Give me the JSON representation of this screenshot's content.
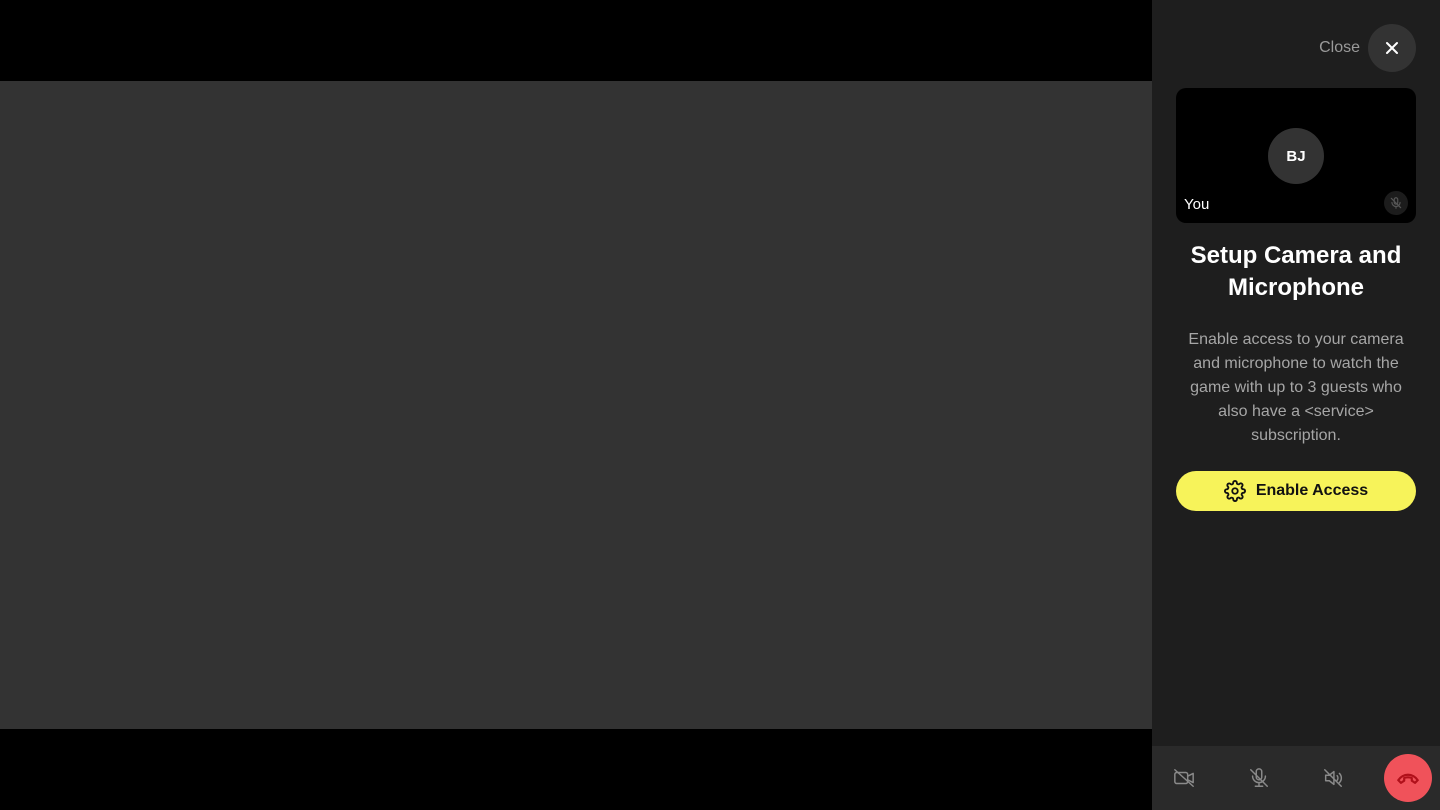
{
  "panel": {
    "close_label": "Close",
    "preview": {
      "initials": "BJ",
      "self_label": "You"
    },
    "title": "Setup Camera and Microphone",
    "description": "Enable access to your camera and microphone to watch the game with up to 3 guests who also have a <service> subscription.",
    "enable_button_label": "Enable Access"
  },
  "controls": {
    "icons": [
      "camera-off-icon",
      "mic-off-icon",
      "speaker-off-icon",
      "hang-up-icon"
    ]
  },
  "colors": {
    "accent": "#f7f35a",
    "hangup": "#f0525a",
    "panel_bg": "#1e1e1e",
    "video_bg": "#333333"
  }
}
